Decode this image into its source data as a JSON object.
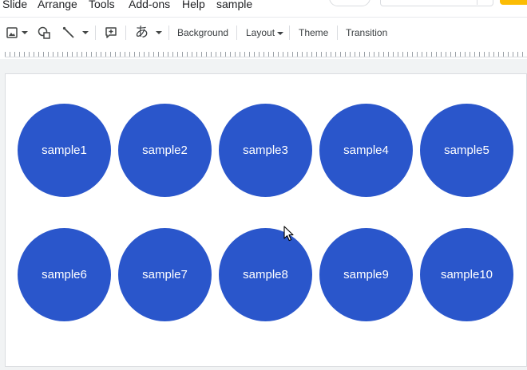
{
  "menubar": {
    "items": [
      "Slide",
      "Arrange",
      "Tools",
      "Add-ons",
      "Help",
      "sample"
    ]
  },
  "header": {
    "accent_color": "#fbbc04"
  },
  "toolbar": {
    "tools": [
      {
        "icon": "image-icon",
        "dropdown": true
      },
      {
        "icon": "shape-icon",
        "dropdown": false
      },
      {
        "icon": "line-icon",
        "dropdown": true
      },
      {
        "icon": "add-comment-icon",
        "dropdown": false
      }
    ],
    "input_tools_glyph": "あ",
    "background_label": "Background",
    "layout_label": "Layout",
    "theme_label": "Theme",
    "transition_label": "Transition"
  },
  "slide": {
    "shape_color": "#2a56cb",
    "shape_text_color": "#ffffff",
    "shapes": [
      {
        "label": "sample1"
      },
      {
        "label": "sample2"
      },
      {
        "label": "sample3"
      },
      {
        "label": "sample4"
      },
      {
        "label": "sample5"
      },
      {
        "label": "sample6"
      },
      {
        "label": "sample7"
      },
      {
        "label": "sample8"
      },
      {
        "label": "sample9"
      },
      {
        "label": "sample10"
      }
    ]
  },
  "colors": {
    "workspace_bg": "#f1f3f4",
    "border": "#dadce0"
  }
}
